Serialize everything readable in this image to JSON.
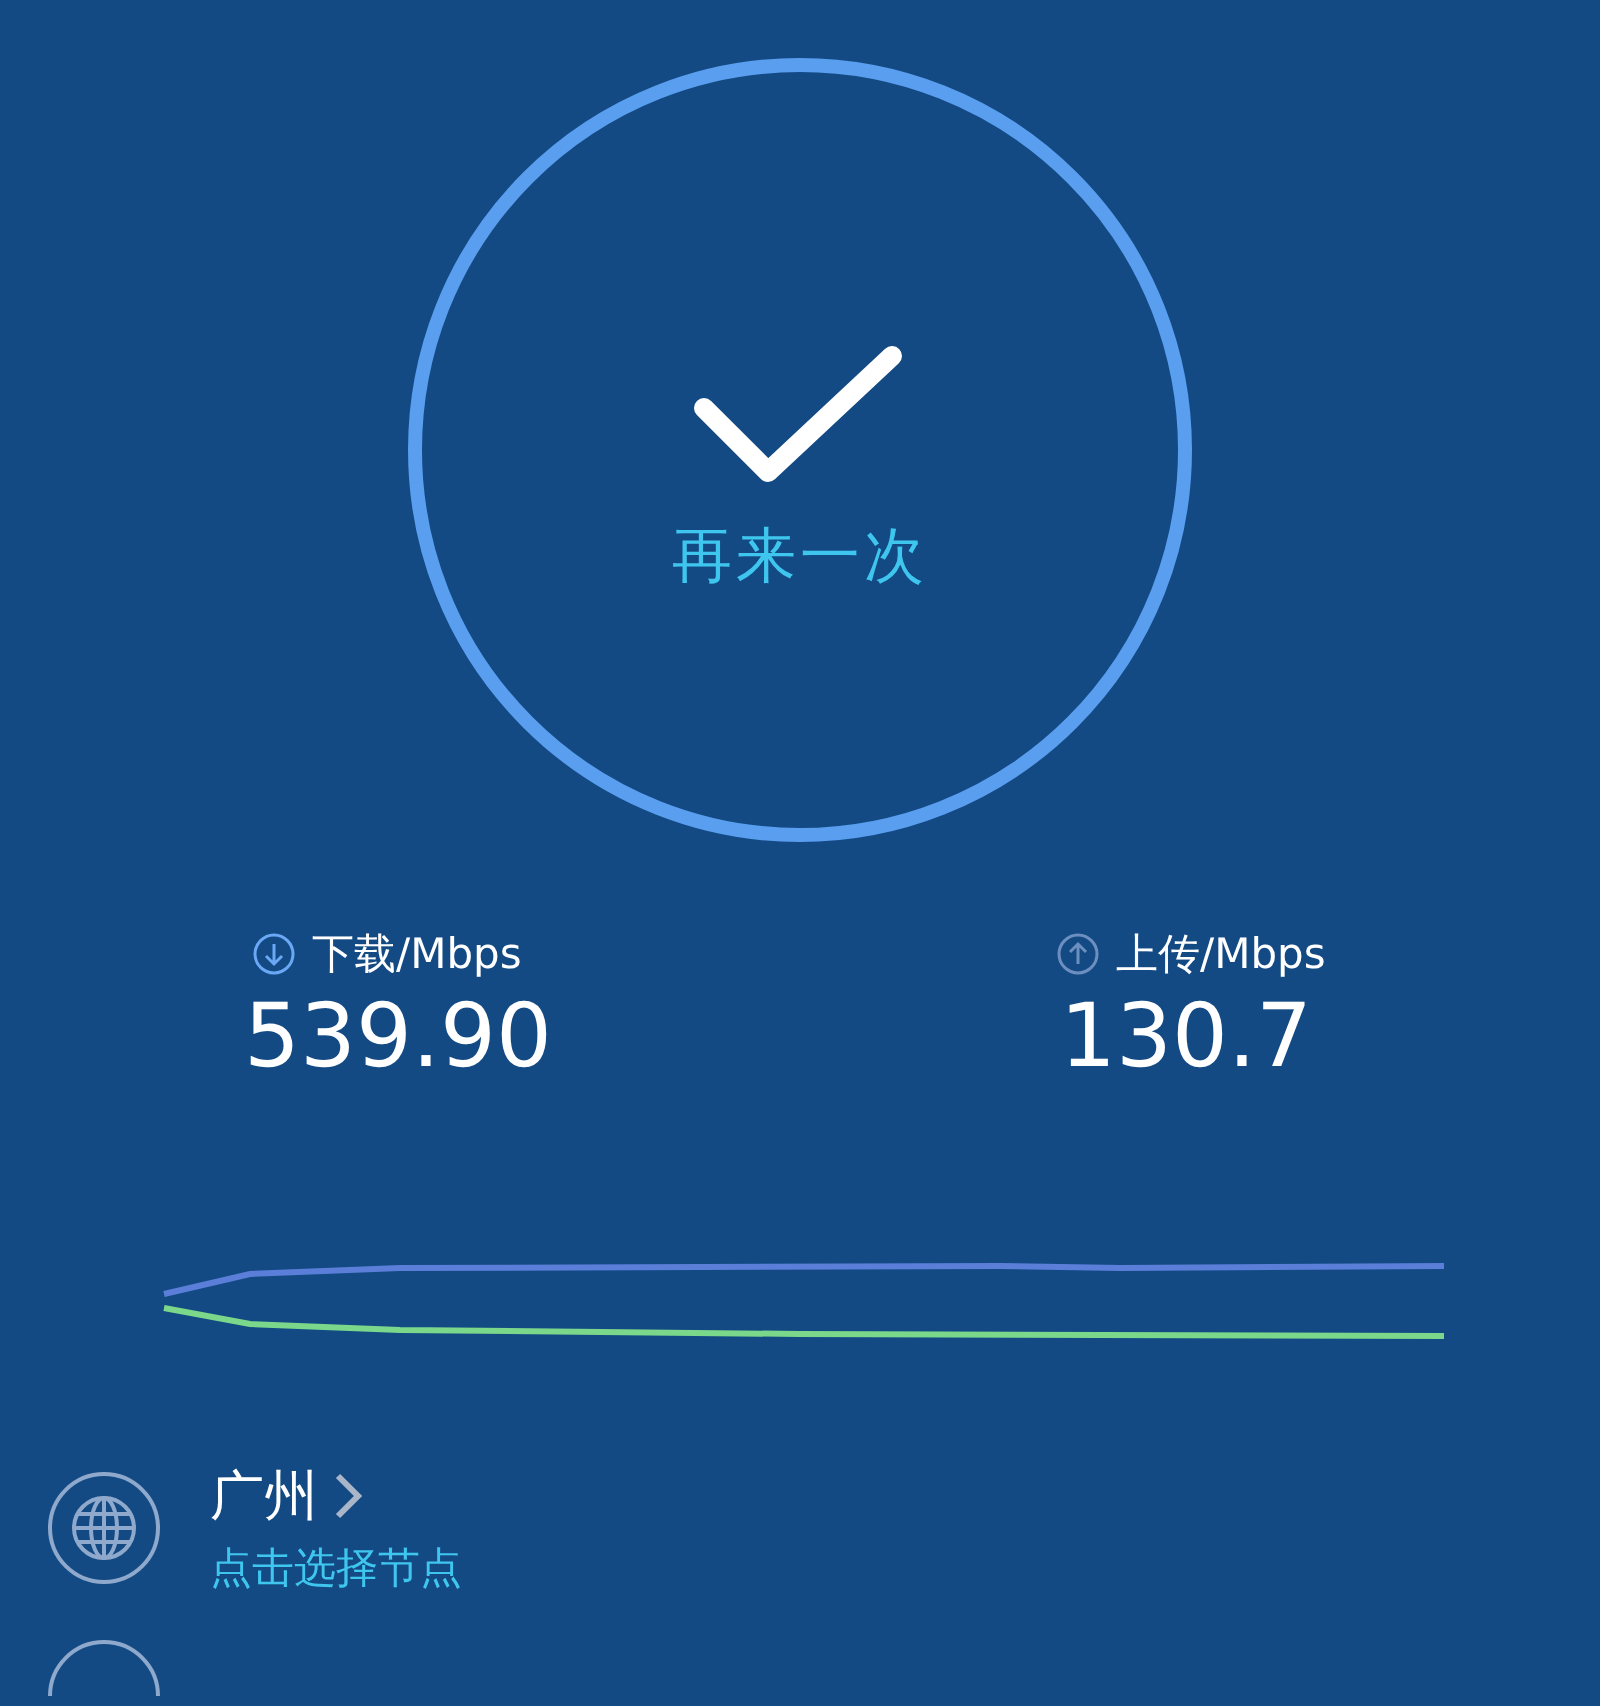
{
  "test_button": {
    "label": "再来一次",
    "done": true
  },
  "results": [
    {
      "kind": "download",
      "label": "下载/Mbps",
      "value": "539.90"
    },
    {
      "kind": "upload",
      "label": "上传/Mbps",
      "value": "130.7"
    }
  ],
  "node": {
    "city": "广州",
    "hint": "点击选择节点"
  }
}
